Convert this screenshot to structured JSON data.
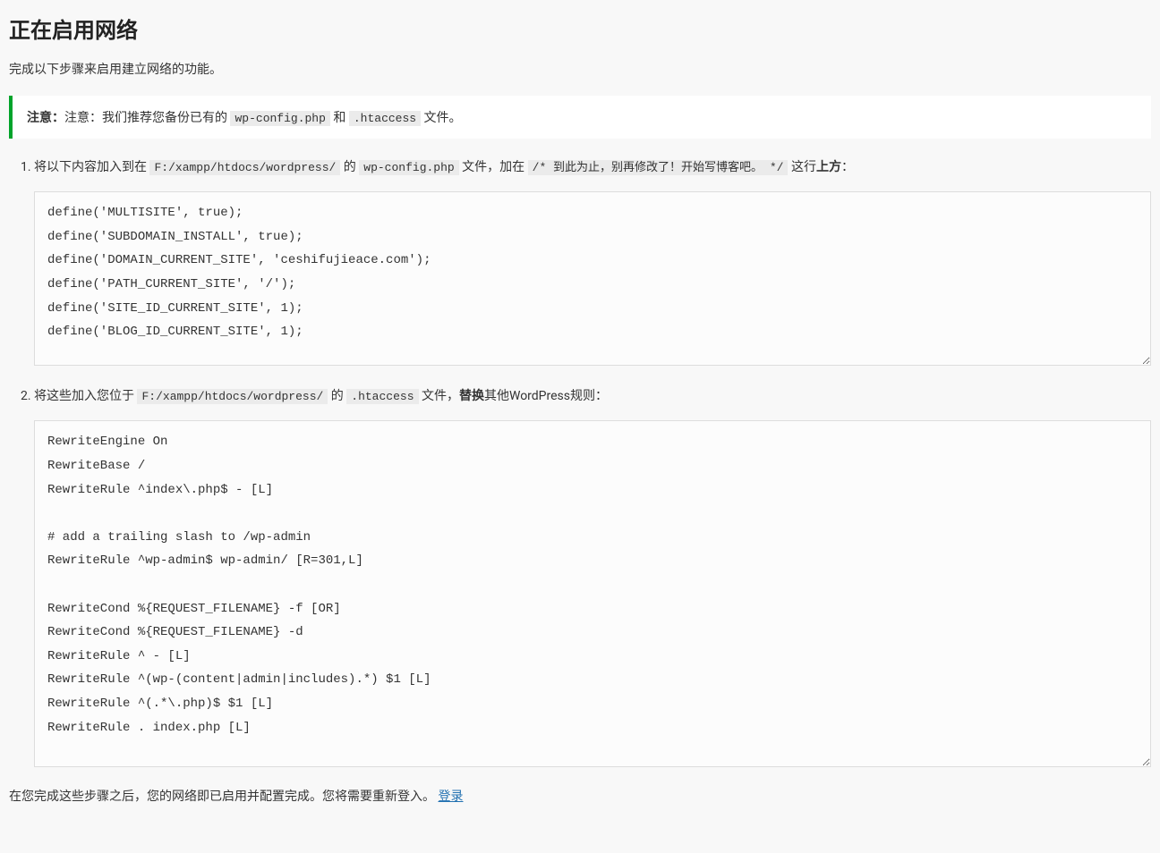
{
  "title": "正在启用网络",
  "intro": "完成以下步骤来启用建立网络的功能。",
  "notice": {
    "prefix_bold": "注意：",
    "label": "注意：",
    "text_before": "我们推荐您备份已有的 ",
    "code1": "wp-config.php",
    "text_mid": " 和 ",
    "code2": ".htaccess",
    "text_after": " 文件。"
  },
  "steps": {
    "s1": {
      "t1": "将以下内容加入到在 ",
      "code_path": "F:/xampp/htdocs/wordpress/",
      "t2": " 的 ",
      "code_file": "wp-config.php",
      "t3": " 文件，加在 ",
      "code_comment": "/*  到此为止，别再修改了！开始写博客吧。  */",
      "t4": " 这行",
      "bold": "上方",
      "t5": "：",
      "code": "define('MULTISITE', true);\ndefine('SUBDOMAIN_INSTALL', true);\ndefine('DOMAIN_CURRENT_SITE', 'ceshifujieace.com');\ndefine('PATH_CURRENT_SITE', '/');\ndefine('SITE_ID_CURRENT_SITE', 1);\ndefine('BLOG_ID_CURRENT_SITE', 1);"
    },
    "s2": {
      "t1": "将这些加入您位于 ",
      "code_path": "F:/xampp/htdocs/wordpress/",
      "t2": " 的 ",
      "code_file": ".htaccess",
      "t3": " 文件，",
      "bold": "替换",
      "t4": "其他WordPress规则：",
      "code": "RewriteEngine On\nRewriteBase /\nRewriteRule ^index\\.php$ - [L]\n\n# add a trailing slash to /wp-admin\nRewriteRule ^wp-admin$ wp-admin/ [R=301,L]\n\nRewriteCond %{REQUEST_FILENAME} -f [OR]\nRewriteCond %{REQUEST_FILENAME} -d\nRewriteRule ^ - [L]\nRewriteRule ^(wp-(content|admin|includes).*) $1 [L]\nRewriteRule ^(.*\\.php)$ $1 [L]\nRewriteRule . index.php [L]"
    }
  },
  "footer": {
    "text": "在您完成这些步骤之后，您的网络即已启用并配置完成。您将需要重新登入。 ",
    "link": "登录"
  }
}
